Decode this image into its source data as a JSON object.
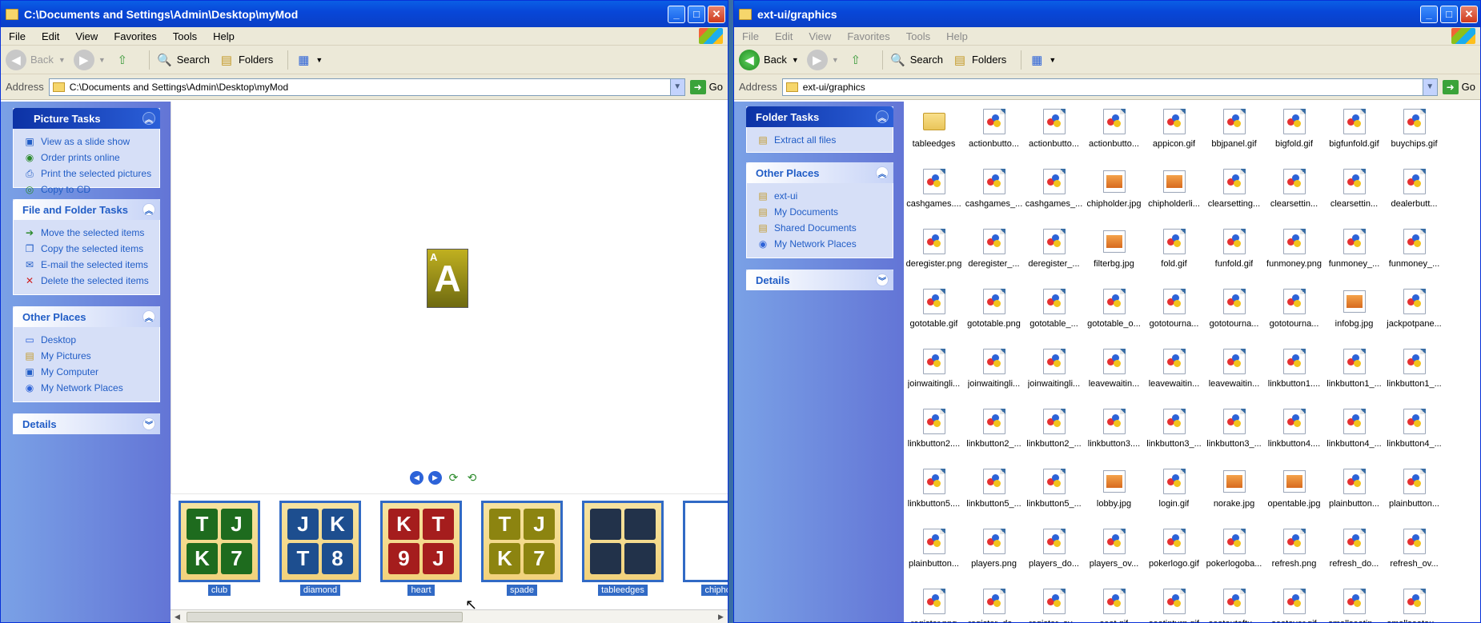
{
  "window1": {
    "title": "C:\\Documents and Settings\\Admin\\Desktop\\myMod",
    "menu": [
      "File",
      "Edit",
      "View",
      "Favorites",
      "Tools",
      "Help"
    ],
    "toolbar": {
      "back": "Back",
      "search": "Search",
      "folders": "Folders"
    },
    "address_label": "Address",
    "address_value": "C:\\Documents and Settings\\Admin\\Desktop\\myMod",
    "go_label": "Go",
    "picture_tasks": {
      "title": "Picture Tasks",
      "items": [
        "View as a slide show",
        "Order prints online",
        "Print the selected pictures",
        "Copy to CD"
      ]
    },
    "file_folder_tasks": {
      "title": "File and Folder Tasks",
      "items": [
        "Move the selected items",
        "Copy the selected items",
        "E-mail the selected items",
        "Delete the selected items"
      ]
    },
    "other_places": {
      "title": "Other Places",
      "items": [
        "Desktop",
        "My Pictures",
        "My Computer",
        "My Network Places"
      ]
    },
    "details": {
      "title": "Details"
    },
    "preview_card": {
      "corner": "A",
      "letter": "A"
    },
    "filmstrip": [
      {
        "name": "club",
        "cards": [
          "T",
          "J",
          "K",
          "7"
        ],
        "color": "#1e6b1e"
      },
      {
        "name": "diamond",
        "cards": [
          "J",
          "K",
          "T",
          "8"
        ],
        "color": "#1d4e8f"
      },
      {
        "name": "heart",
        "cards": [
          "K",
          "T",
          "9",
          "J"
        ],
        "color": "#a51d1d"
      },
      {
        "name": "spade",
        "cards": [
          "T",
          "J",
          "K",
          "7"
        ],
        "color": "#8c8410"
      },
      {
        "name": "tableedges",
        "cards": [
          "",
          "",
          "",
          ""
        ],
        "color": "#22324a"
      },
      {
        "name": "chipholde",
        "cards": [],
        "color": "#ffffff"
      }
    ]
  },
  "window2": {
    "title": "ext-ui/graphics",
    "menu": [
      "File",
      "Edit",
      "View",
      "Favorites",
      "Tools",
      "Help"
    ],
    "toolbar": {
      "back": "Back",
      "search": "Search",
      "folders": "Folders"
    },
    "address_label": "Address",
    "address_value": "ext-ui/graphics",
    "go_label": "Go",
    "folder_tasks": {
      "title": "Folder Tasks",
      "items": [
        "Extract all files"
      ]
    },
    "other_places": {
      "title": "Other Places",
      "items": [
        "ext-ui",
        "My Documents",
        "Shared Documents",
        "My Network Places"
      ]
    },
    "details": {
      "title": "Details"
    },
    "files": [
      {
        "name": "tableedges",
        "kind": "folder"
      },
      {
        "name": "actionbutto...",
        "kind": "gif"
      },
      {
        "name": "actionbutto...",
        "kind": "gif"
      },
      {
        "name": "actionbutto...",
        "kind": "gif"
      },
      {
        "name": "appicon.gif",
        "kind": "gif"
      },
      {
        "name": "bbjpanel.gif",
        "kind": "gif"
      },
      {
        "name": "bigfold.gif",
        "kind": "gif"
      },
      {
        "name": "bigfunfold.gif",
        "kind": "gif"
      },
      {
        "name": "buychips.gif",
        "kind": "gif"
      },
      {
        "name": "cashgames....",
        "kind": "gif"
      },
      {
        "name": "cashgames_...",
        "kind": "gif"
      },
      {
        "name": "cashgames_...",
        "kind": "gif"
      },
      {
        "name": "chipholder.jpg",
        "kind": "jpg"
      },
      {
        "name": "chipholderli...",
        "kind": "jpg"
      },
      {
        "name": "clearsetting...",
        "kind": "gif"
      },
      {
        "name": "clearsettin...",
        "kind": "gif"
      },
      {
        "name": "clearsettin...",
        "kind": "gif"
      },
      {
        "name": "dealerbutt...",
        "kind": "gif"
      },
      {
        "name": "deregister.png",
        "kind": "gif"
      },
      {
        "name": "deregister_...",
        "kind": "gif"
      },
      {
        "name": "deregister_...",
        "kind": "gif"
      },
      {
        "name": "filterbg.jpg",
        "kind": "jpg"
      },
      {
        "name": "fold.gif",
        "kind": "gif"
      },
      {
        "name": "funfold.gif",
        "kind": "gif"
      },
      {
        "name": "funmoney.png",
        "kind": "gif"
      },
      {
        "name": "funmoney_...",
        "kind": "gif"
      },
      {
        "name": "funmoney_...",
        "kind": "gif"
      },
      {
        "name": "gototable.gif",
        "kind": "gif"
      },
      {
        "name": "gototable.png",
        "kind": "gif"
      },
      {
        "name": "gototable_...",
        "kind": "gif"
      },
      {
        "name": "gototable_o...",
        "kind": "gif"
      },
      {
        "name": "gototourna...",
        "kind": "gif"
      },
      {
        "name": "gototourna...",
        "kind": "gif"
      },
      {
        "name": "gototourna...",
        "kind": "gif"
      },
      {
        "name": "infobg.jpg",
        "kind": "jpg"
      },
      {
        "name": "jackpotpane...",
        "kind": "gif"
      },
      {
        "name": "joinwaitingli...",
        "kind": "gif"
      },
      {
        "name": "joinwaitingli...",
        "kind": "gif"
      },
      {
        "name": "joinwaitingli...",
        "kind": "gif"
      },
      {
        "name": "leavewaitin...",
        "kind": "gif"
      },
      {
        "name": "leavewaitin...",
        "kind": "gif"
      },
      {
        "name": "leavewaitin...",
        "kind": "gif"
      },
      {
        "name": "linkbutton1....",
        "kind": "gif"
      },
      {
        "name": "linkbutton1_...",
        "kind": "gif"
      },
      {
        "name": "linkbutton1_...",
        "kind": "gif"
      },
      {
        "name": "linkbutton2....",
        "kind": "gif"
      },
      {
        "name": "linkbutton2_...",
        "kind": "gif"
      },
      {
        "name": "linkbutton2_...",
        "kind": "gif"
      },
      {
        "name": "linkbutton3....",
        "kind": "gif"
      },
      {
        "name": "linkbutton3_...",
        "kind": "gif"
      },
      {
        "name": "linkbutton3_...",
        "kind": "gif"
      },
      {
        "name": "linkbutton4....",
        "kind": "gif"
      },
      {
        "name": "linkbutton4_...",
        "kind": "gif"
      },
      {
        "name": "linkbutton4_...",
        "kind": "gif"
      },
      {
        "name": "linkbutton5....",
        "kind": "gif"
      },
      {
        "name": "linkbutton5_...",
        "kind": "gif"
      },
      {
        "name": "linkbutton5_...",
        "kind": "gif"
      },
      {
        "name": "lobby.jpg",
        "kind": "jpg"
      },
      {
        "name": "login.gif",
        "kind": "gif"
      },
      {
        "name": "norake.jpg",
        "kind": "jpg"
      },
      {
        "name": "opentable.jpg",
        "kind": "jpg"
      },
      {
        "name": "plainbutton...",
        "kind": "gif"
      },
      {
        "name": "plainbutton...",
        "kind": "gif"
      },
      {
        "name": "plainbutton...",
        "kind": "gif"
      },
      {
        "name": "players.png",
        "kind": "gif"
      },
      {
        "name": "players_do...",
        "kind": "gif"
      },
      {
        "name": "players_ov...",
        "kind": "gif"
      },
      {
        "name": "pokerlogo.gif",
        "kind": "gif"
      },
      {
        "name": "pokerlogoba...",
        "kind": "gif"
      },
      {
        "name": "refresh.png",
        "kind": "gif"
      },
      {
        "name": "refresh_do...",
        "kind": "gif"
      },
      {
        "name": "refresh_ov...",
        "kind": "gif"
      },
      {
        "name": "register.png",
        "kind": "gif"
      },
      {
        "name": "register_do...",
        "kind": "gif"
      },
      {
        "name": "register_ov...",
        "kind": "gif"
      },
      {
        "name": "seat.gif",
        "kind": "gif"
      },
      {
        "name": "seatinturn.gif",
        "kind": "gif"
      },
      {
        "name": "seatoutoftu...",
        "kind": "gif"
      },
      {
        "name": "seatover.gif",
        "kind": "gif"
      },
      {
        "name": "smallseatin...",
        "kind": "gif"
      },
      {
        "name": "smallseatou...",
        "kind": "gif"
      }
    ]
  }
}
